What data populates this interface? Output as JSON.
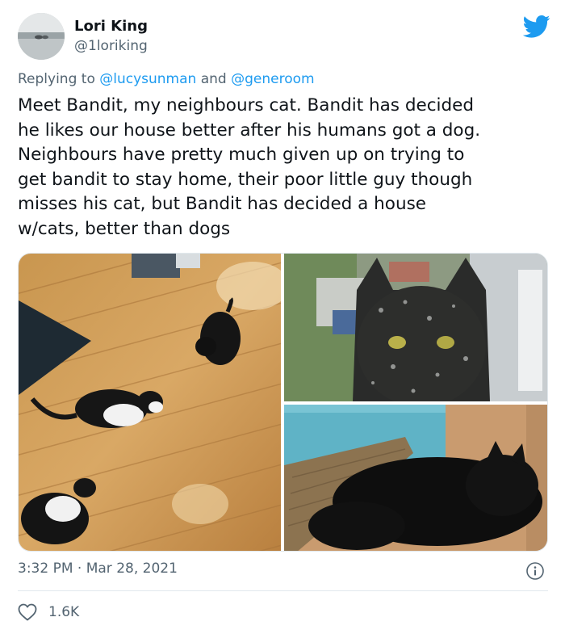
{
  "author": {
    "name": "Lori King",
    "handle": "@1loriking",
    "avatar_icon": "avatar-lake-photo",
    "brand_icon": "twitter-bird-icon",
    "brand_color": "#1d9bf0"
  },
  "reply": {
    "prefix": "Replying to",
    "mention_1": "@lucysunman",
    "joiner": "and",
    "mention_2": "@generoom",
    "mention_color": "#1d9bf0"
  },
  "tweet": {
    "lines": [
      "Meet Bandit, my neighbours cat. Bandit has decided",
      "he likes our house better after his humans got a dog.",
      "Neighbours have pretty much given up on trying to",
      "get bandit to stay home, their poor little guy though",
      "misses his cat, but Bandit has decided a house",
      "w/cats, better than dogs"
    ]
  },
  "media": {
    "photos": [
      {
        "icon": "three-cats-on-floor-photo"
      },
      {
        "icon": "black-cat-at-window-photo"
      },
      {
        "icon": "black-cat-on-scratcher-photo"
      }
    ]
  },
  "meta": {
    "time": "3:32 PM",
    "separator": "·",
    "date": "Mar 28, 2021",
    "info_icon": "info-icon"
  },
  "engagement": {
    "like_icon": "heart-icon",
    "likes": "1.6K"
  }
}
